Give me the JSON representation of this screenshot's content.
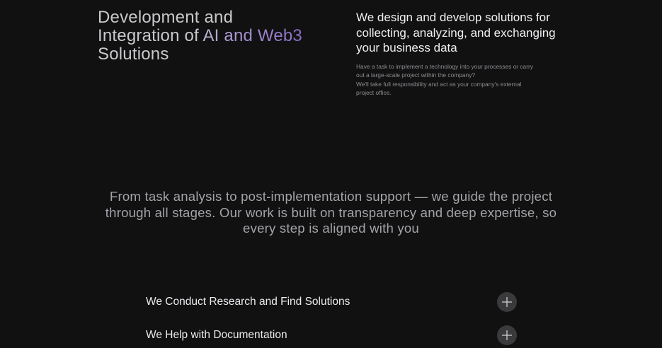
{
  "hero": {
    "title_line1": "Development and",
    "title_line2_prefix": "Integration of ",
    "title_line2_accent": "AI and Web3",
    "title_line3": "Solutions"
  },
  "intro": {
    "heading": "We design and develop solutions for collecting, analyzing, and exchanging your business data",
    "body_line1": "Have a task to implement a technology into your processes or carry out a large-scale project within the company?",
    "body_line2": "We'll take full responsibility and act as your company's external project office."
  },
  "statement": {
    "text": "From task analysis to post-implementation support — we guide the project through all stages. Our work is built on transparency and deep expertise, so every step is aligned with you"
  },
  "services": {
    "items": [
      {
        "label": "We Conduct Research and Find Solutions",
        "icon": "plus-icon"
      },
      {
        "label": "We Help with Documentation",
        "icon": "plus-icon"
      }
    ]
  },
  "colors": {
    "background": "#111112",
    "accent_gradient_start": "#bfb6d9",
    "accent_gradient_end": "#8a6cc4",
    "button_bg": "#3a3a3d"
  }
}
